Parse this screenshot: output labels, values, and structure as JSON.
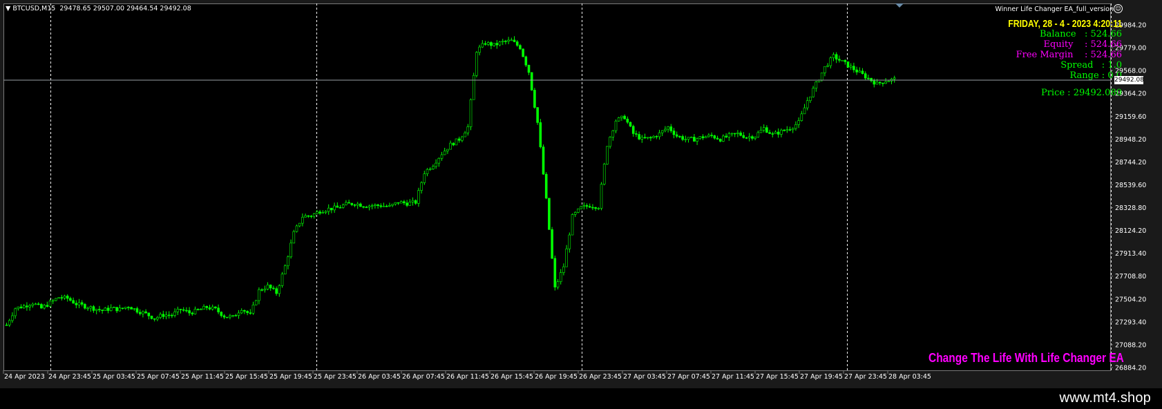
{
  "header": {
    "symbol_menu_arrow": "▼",
    "symbol_info": "BTCUSD,M15  29478.65 29507.00 29464.54 29492.08"
  },
  "ea_panel": {
    "ea_name": "Winner Life Changer EA_full_version",
    "smiley_icon": "smiley-icon",
    "date_text": "FRIDAY, 28 - 4 - 2023 4:20:11",
    "balance_label": "Balance   : 524.66",
    "equity_label": "Equity    : 524.66",
    "free_margin_label": "Free Margin    : 524.66",
    "spread_label": "Spread   : 1.0",
    "range_label": "Range : 0.0",
    "price_label": "Price : 29492.080",
    "slogan": "Change The Life With Life Changer EA"
  },
  "footer": {
    "site": "www.mt4.shop"
  },
  "colors": {
    "background": "#000000",
    "candles": "#00ff00",
    "date_text": "#ffff00",
    "balance": "#00ff00",
    "equity": "#ff00ff",
    "free_margin": "#ff00ff",
    "spread": "#00ff00",
    "range": "#00ff00",
    "price": "#00ff00",
    "slogan": "#ff00ff",
    "grid": "#ffffff",
    "current_price_line": "#9aa0a6"
  },
  "chart_data": {
    "type": "candlestick",
    "symbol": "BTCUSD",
    "timeframe": "M15",
    "current_price": 29492.08,
    "y_tick_labels": [
      "29984.20",
      "29779.00",
      "29568.00",
      "29364.20",
      "29159.60",
      "28948.20",
      "28744.20",
      "28539.60",
      "28328.80",
      "28124.20",
      "27913.40",
      "27708.80",
      "27504.20",
      "27293.40",
      "27088.20",
      "26884.20"
    ],
    "current_price_tag": "29492.08",
    "ylim": [
      26884.2,
      29984.2
    ],
    "x_tick_labels": [
      "24 Apr 2023",
      "24 Apr 23:45",
      "25 Apr 03:45",
      "25 Apr 07:45",
      "25 Apr 11:45",
      "25 Apr 15:45",
      "25 Apr 19:45",
      "25 Apr 23:45",
      "26 Apr 03:45",
      "26 Apr 07:45",
      "26 Apr 11:45",
      "26 Apr 15:45",
      "26 Apr 19:45",
      "26 Apr 23:45",
      "27 Apr 03:45",
      "27 Apr 07:45",
      "27 Apr 11:45",
      "27 Apr 15:45",
      "27 Apr 19:45",
      "27 Apr 23:45",
      "28 Apr 03:45"
    ],
    "price_path": [
      27270,
      27420,
      27440,
      27470,
      27420,
      27470,
      27520,
      27510,
      27460,
      27440,
      27420,
      27400,
      27420,
      27410,
      27440,
      27400,
      27370,
      27330,
      27360,
      27360,
      27410,
      27380,
      27400,
      27430,
      27410,
      27350,
      27340,
      27420,
      27360,
      27580,
      27620,
      27560,
      27800,
      28100,
      28250,
      28260,
      28300,
      28320,
      28330,
      28360,
      28370,
      28350,
      28350,
      28350,
      28340,
      28380,
      28370,
      28380,
      28650,
      28720,
      28820,
      28900,
      28950,
      29060,
      29750,
      29820,
      29800,
      29830,
      29840,
      29780,
      29560,
      29100,
      28400,
      27600,
      27800,
      28250,
      28330,
      28350,
      28340,
      28900,
      29120,
      29150,
      29000,
      28950,
      28960,
      29000,
      29060,
      28980,
      28950,
      28950,
      28970,
      28980,
      28950,
      28980,
      29000,
      28970,
      28980,
      29050,
      28990,
      29020,
      29050,
      29100,
      29300,
      29450,
      29600,
      29700,
      29650,
      29600,
      29550,
      29500,
      29450,
      29480,
      29492
    ]
  }
}
